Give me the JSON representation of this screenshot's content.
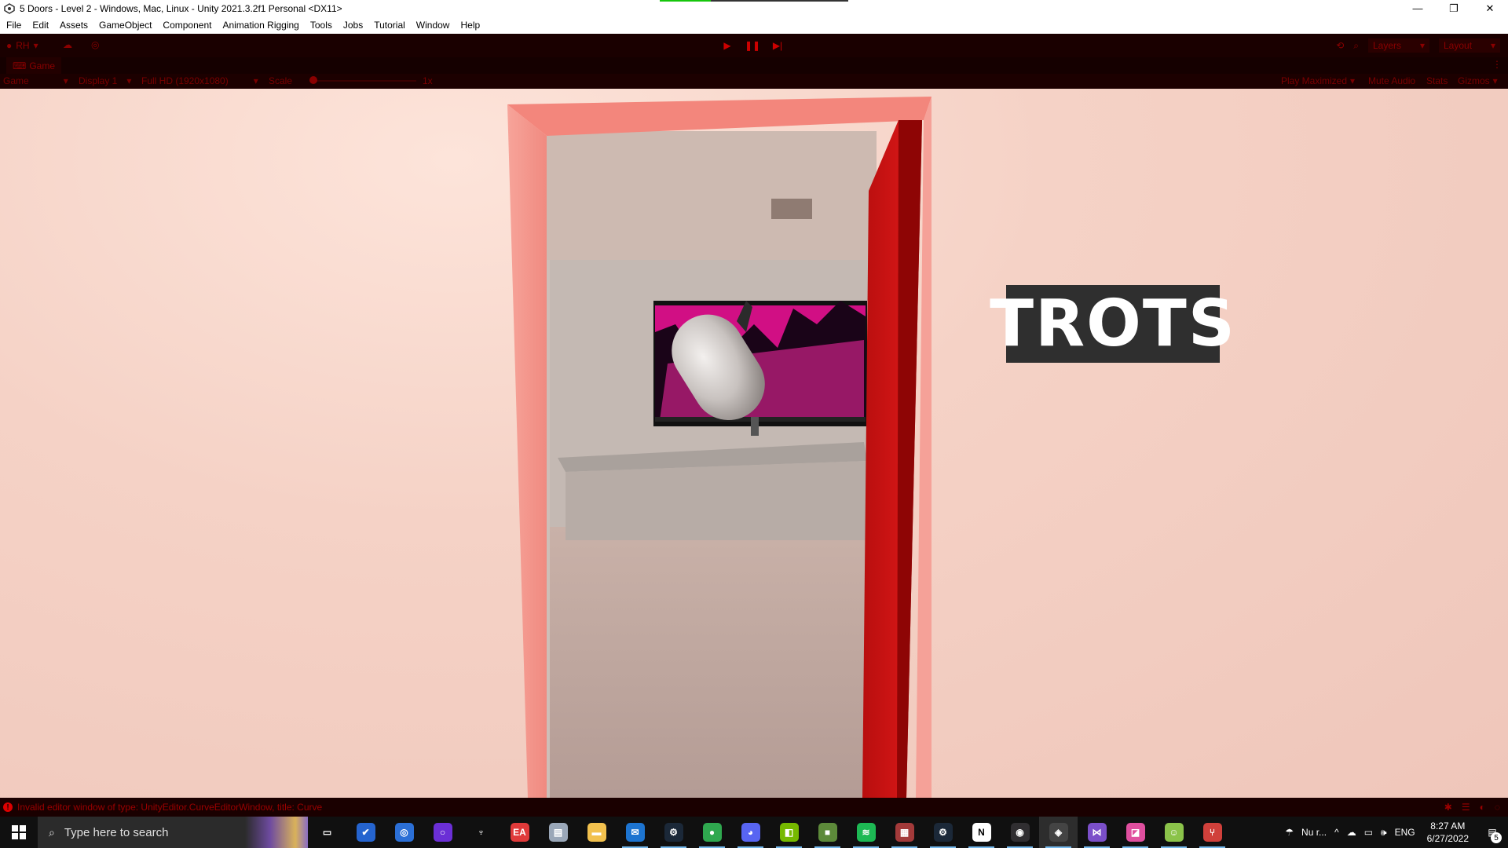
{
  "window": {
    "title": "5 Doors - Level 2 - Windows, Mac, Linux - Unity 2021.3.2f1 Personal <DX11>",
    "progress": 0.27,
    "controls": [
      "minimize-icon",
      "restore-icon",
      "close-icon"
    ]
  },
  "menu": [
    "File",
    "Edit",
    "Assets",
    "GameObject",
    "Component",
    "Animation Rigging",
    "Tools",
    "Jobs",
    "Tutorial",
    "Window",
    "Help"
  ],
  "toolbar": {
    "account": "RH",
    "layers_label": "Layers",
    "layout_label": "Layout"
  },
  "game_tab": {
    "label": "Game"
  },
  "game_bar": {
    "mode": "Game",
    "display": "Display 1",
    "resolution": "Full HD (1920x1080)",
    "scale_label": "Scale",
    "scale_value": "1x",
    "play_maximized": "Play Maximized",
    "mute_audio": "Mute Audio",
    "stats": "Stats",
    "gizmos": "Gizmos"
  },
  "scene": {
    "sign_text": "TROTS"
  },
  "status": {
    "message": "Invalid editor window of type: UnityEditor.CurveEditorWindow, title: Curve"
  },
  "taskbar": {
    "search_placeholder": "Type here to search",
    "weather": "Nu r...",
    "language": "ENG",
    "time": "8:27 AM",
    "date": "6/27/2022",
    "notifications": "5",
    "apps": [
      {
        "name": "task-view-icon",
        "color": "#101010",
        "glyph": "▭"
      },
      {
        "name": "todo-icon",
        "color": "#2564cf",
        "glyph": "✔"
      },
      {
        "name": "ubisoft-icon",
        "color": "#2b6fd6",
        "glyph": "◎"
      },
      {
        "name": "cortana-icon",
        "color": "#6b2fd6",
        "glyph": "○"
      },
      {
        "name": "skyrim-icon",
        "color": "#101010",
        "glyph": "♆"
      },
      {
        "name": "ea-icon",
        "color": "#e03a3a",
        "glyph": "EA"
      },
      {
        "name": "explorer-files-icon",
        "color": "#9aa7b8",
        "glyph": "▤"
      },
      {
        "name": "folder-icon",
        "color": "#f2c14e",
        "glyph": "▬"
      },
      {
        "name": "mail-icon",
        "color": "#1d74d0",
        "glyph": "✉"
      },
      {
        "name": "steam-icon",
        "color": "#1b2838",
        "glyph": "⚙"
      },
      {
        "name": "chrome-icon",
        "color": "#2fa84f",
        "glyph": "●"
      },
      {
        "name": "discord-icon",
        "color": "#5865f2",
        "glyph": "◕"
      },
      {
        "name": "nvidia-icon",
        "color": "#76b900",
        "glyph": "◧"
      },
      {
        "name": "minecraft-icon",
        "color": "#5d8a3a",
        "glyph": "■"
      },
      {
        "name": "spotify-icon",
        "color": "#1db954",
        "glyph": "≋"
      },
      {
        "name": "winrar-icon",
        "color": "#a33a3a",
        "glyph": "▦"
      },
      {
        "name": "steam-2-icon",
        "color": "#1b2838",
        "glyph": "⚙"
      },
      {
        "name": "notion-icon",
        "color": "#ffffff",
        "glyph": "N"
      },
      {
        "name": "obs-icon",
        "color": "#302e31",
        "glyph": "◉"
      },
      {
        "name": "unity-icon",
        "color": "#444444",
        "glyph": "◈"
      },
      {
        "name": "visual-studio-icon",
        "color": "#7b4fc9",
        "glyph": "⋈"
      },
      {
        "name": "paint-icon",
        "color": "#e04f9f",
        "glyph": "◪"
      },
      {
        "name": "android-icon",
        "color": "#8bc34a",
        "glyph": "☺"
      },
      {
        "name": "git-icon",
        "color": "#d0403b",
        "glyph": "⑂"
      }
    ]
  }
}
